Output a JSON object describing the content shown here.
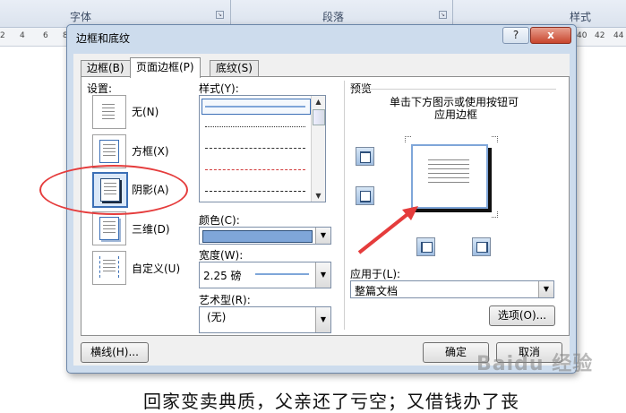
{
  "ribbon": {
    "groups": [
      "字体",
      "段落",
      "样式"
    ]
  },
  "ruler": {
    "numbers": [
      "2",
      "4",
      "6",
      "8",
      "40",
      "42",
      "44"
    ]
  },
  "document": {
    "text": "回家变卖典质，父亲还了亏空；又借钱办了丧"
  },
  "dialog": {
    "title": "边框和底纹",
    "help_label": "?",
    "close_label": "x",
    "tabs": [
      "边框(B)",
      "页面边框(P)",
      "底纹(S)"
    ],
    "active_tab": "页面边框(P)",
    "settings": {
      "label": "设置:",
      "items": [
        {
          "label": "无(N)"
        },
        {
          "label": "方框(X)"
        },
        {
          "label": "阴影(A)",
          "selected": true
        },
        {
          "label": "三维(D)"
        },
        {
          "label": "自定义(U)"
        }
      ]
    },
    "style": {
      "label": "样式(Y):",
      "options": [
        "solid",
        "dotted",
        "dashed",
        "dashed-red",
        "dash-dot"
      ],
      "selected": "solid"
    },
    "color": {
      "label": "颜色(C):",
      "value_hex": "#7fa6d9"
    },
    "width": {
      "label": "宽度(W):",
      "value": "2.25 磅"
    },
    "art": {
      "label": "艺术型(R):",
      "value": "(无)"
    },
    "preview": {
      "label": "预览",
      "instruction_line1": "单击下方图示或使用按钮可",
      "instruction_line2": "应用边框"
    },
    "apply_to": {
      "label": "应用于(L):",
      "value": "整篇文档"
    },
    "buttons": {
      "options": "选项(O)...",
      "horizontal_line": "横线(H)...",
      "ok": "确定",
      "cancel": "取消"
    }
  },
  "watermark": {
    "text": "Baidu 经验"
  },
  "colors": {
    "accent": "#3b6fb6",
    "annotation": "#e53c3c",
    "dialog_frame": "#cddced"
  }
}
